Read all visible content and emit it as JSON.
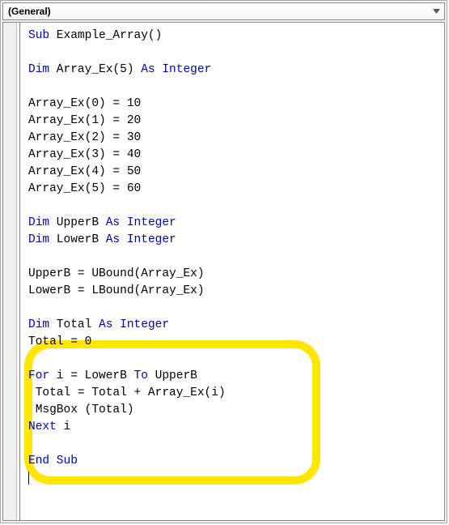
{
  "dropdown": {
    "selected": "(General)"
  },
  "code": {
    "l1": {
      "kw1": "Sub",
      "rest": " Example_Array()"
    },
    "l2": "",
    "l3": {
      "kw1": "Dim",
      "mid": " Array_Ex(5) ",
      "kw2": "As Integer"
    },
    "l4": "",
    "l5": "Array_Ex(0) = 10",
    "l6": "Array_Ex(1) = 20",
    "l7": "Array_Ex(2) = 30",
    "l8": "Array_Ex(3) = 40",
    "l9": "Array_Ex(4) = 50",
    "l10": "Array_Ex(5) = 60",
    "l11": "",
    "l12": {
      "kw1": "Dim",
      "mid": " UpperB ",
      "kw2": "As Integer"
    },
    "l13": {
      "kw1": "Dim",
      "mid": " LowerB ",
      "kw2": "As Integer"
    },
    "l14": "",
    "l15": "UpperB = UBound(Array_Ex)",
    "l16": "LowerB = LBound(Array_Ex)",
    "l17": "",
    "l18": {
      "kw1": "Dim",
      "mid": " Total ",
      "kw2": "As Integer"
    },
    "l19": "Total = 0",
    "l20": "",
    "l21": {
      "kw1": "For",
      "mid1": " i = LowerB ",
      "kw2": "To",
      "mid2": " UpperB"
    },
    "l22": " Total = Total + Array_Ex(i)",
    "l23": " MsgBox (Total)",
    "l24": {
      "kw1": "Next",
      "rest": " i"
    },
    "l25": "",
    "l26": {
      "kw1": "End Sub"
    }
  }
}
